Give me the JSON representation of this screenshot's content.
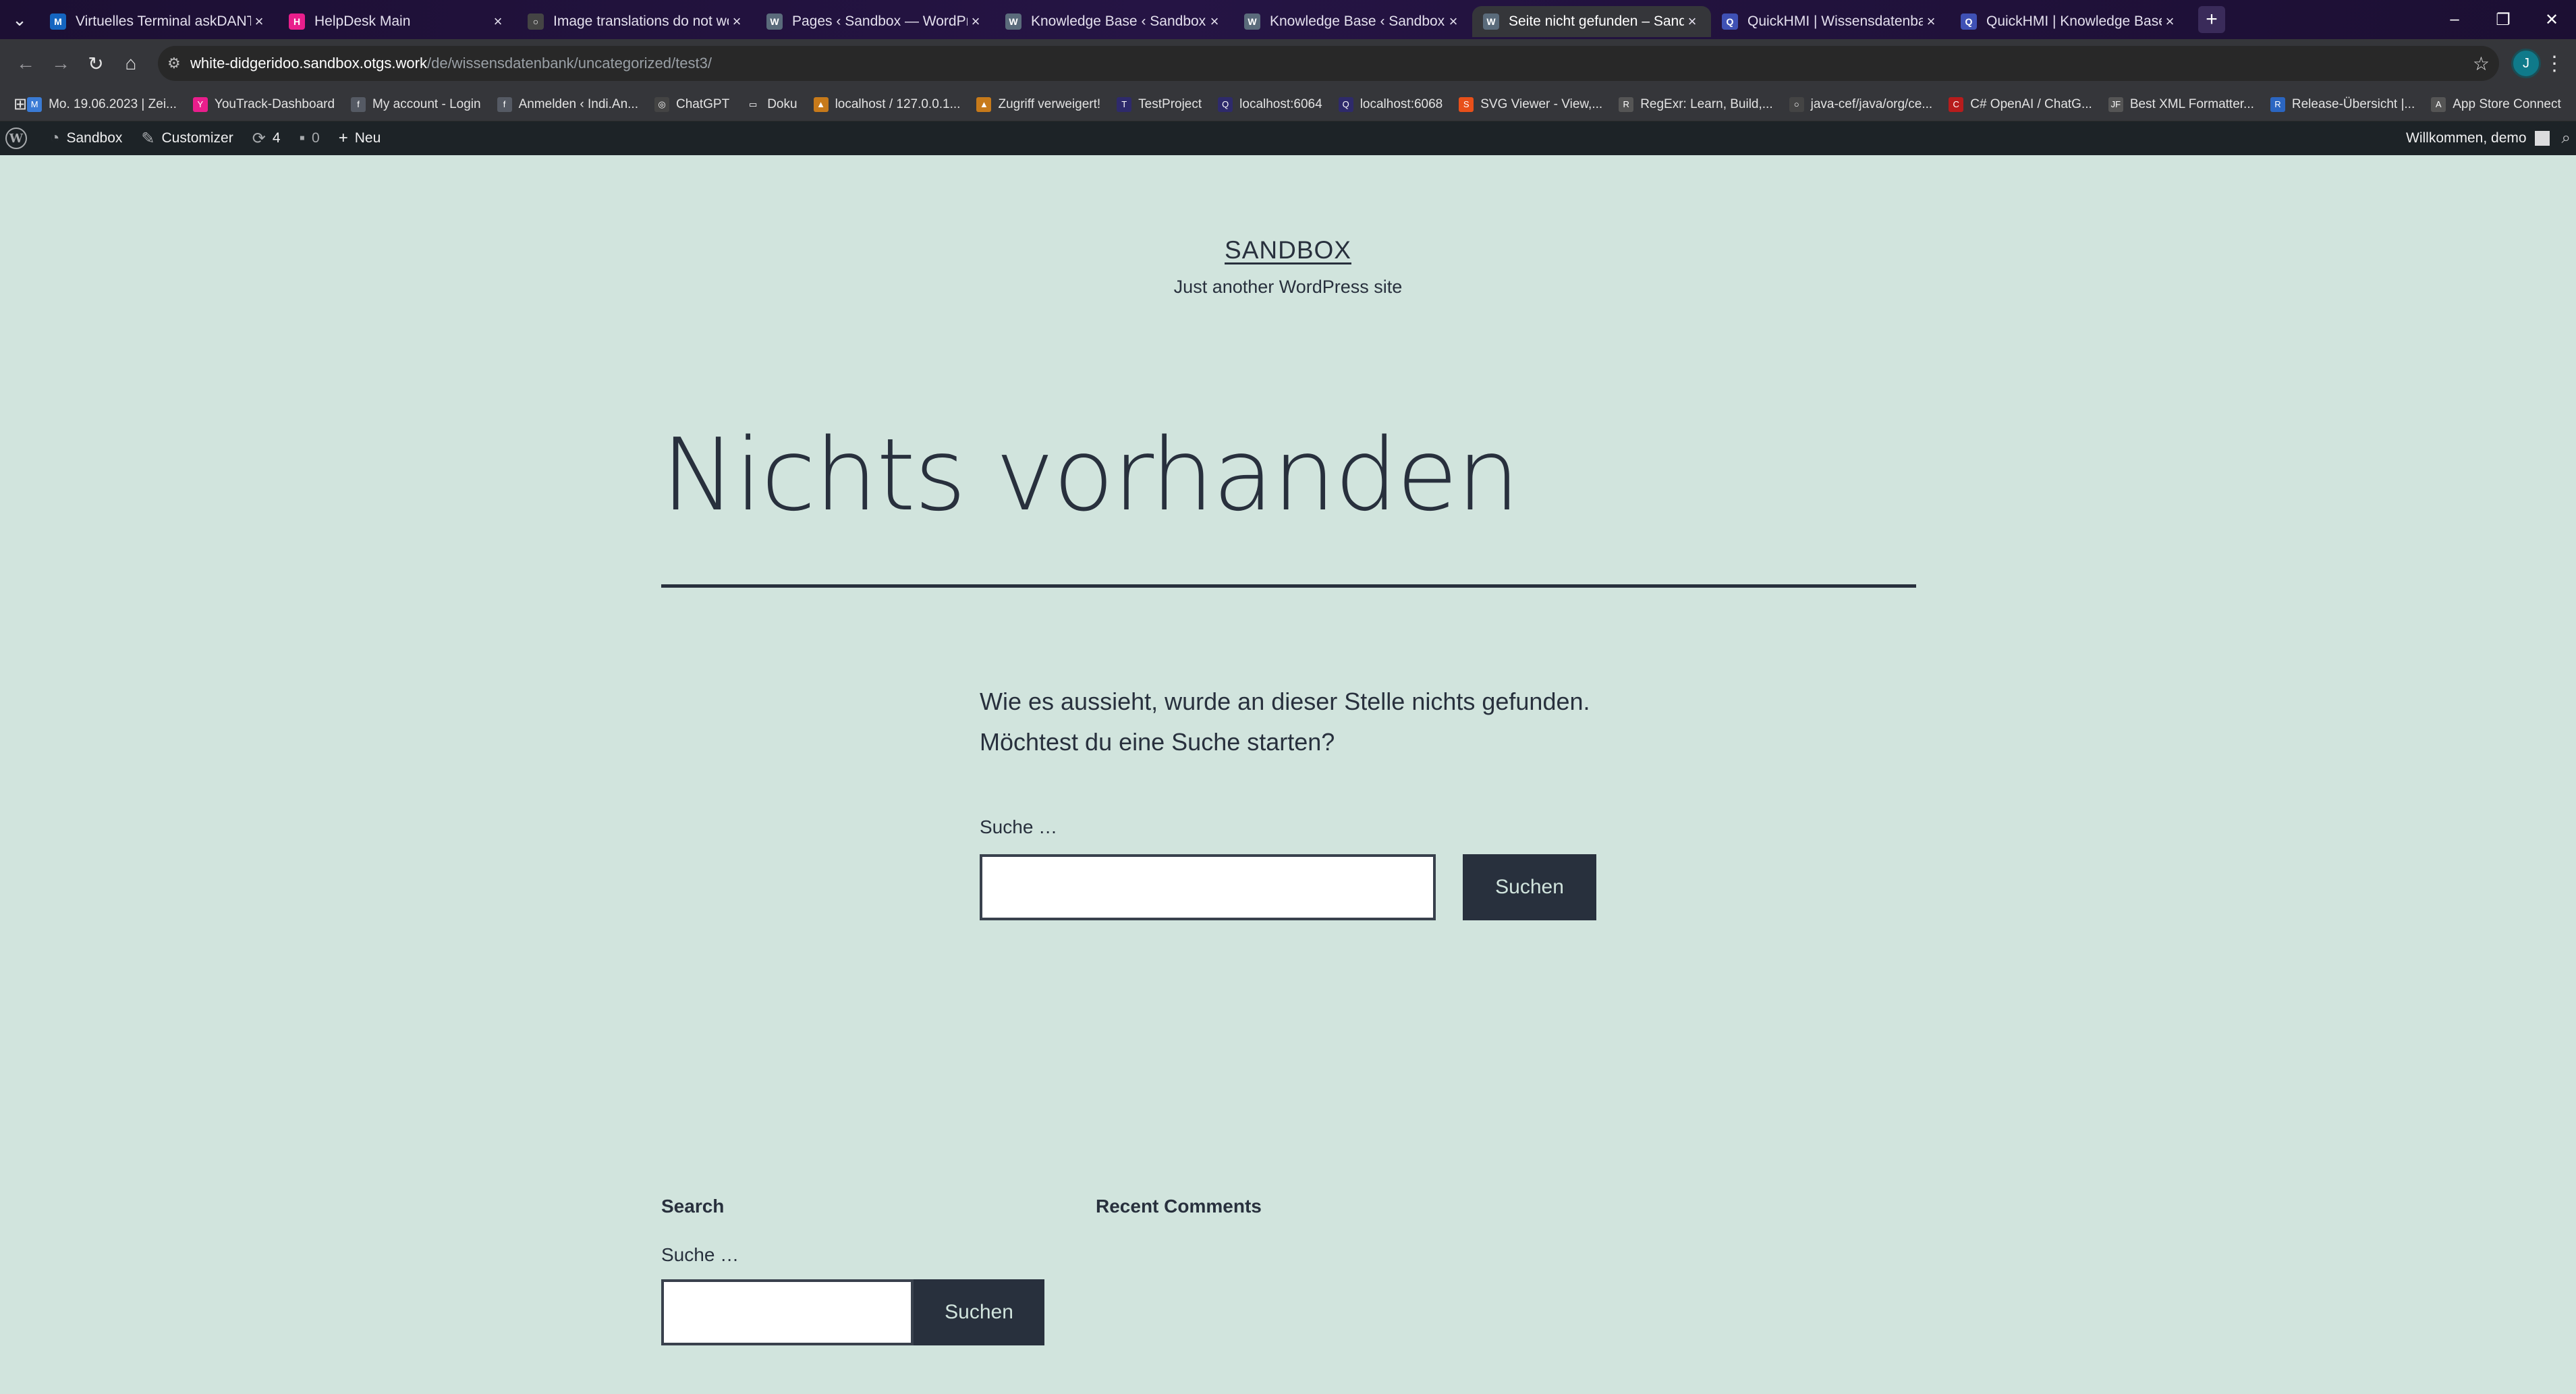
{
  "browser": {
    "tabs": [
      {
        "title": "Virtuelles Terminal askDANTE",
        "icon": "m-logo-icon",
        "color": "#1565c0",
        "glyph": "M"
      },
      {
        "title": "HelpDesk Main",
        "icon": "helpdesk-icon",
        "color": "#e91e8c",
        "glyph": "H"
      },
      {
        "title": "Image translations do not work",
        "icon": "github-icon",
        "color": "#444444",
        "glyph": "○"
      },
      {
        "title": "Pages ‹ Sandbox — WordPress",
        "icon": "wordpress-icon",
        "color": "#5a6b7b",
        "glyph": "W"
      },
      {
        "title": "Knowledge Base ‹ Sandbox — W",
        "icon": "wordpress-icon",
        "color": "#5a6b7b",
        "glyph": "W"
      },
      {
        "title": "Knowledge Base ‹ Sandbox — W",
        "icon": "wordpress-icon",
        "color": "#5a6b7b",
        "glyph": "W"
      },
      {
        "title": "Seite nicht gefunden – Sandbox",
        "icon": "wordpress-icon",
        "color": "#5a6b7b",
        "glyph": "W",
        "active": true
      },
      {
        "title": "QuickHMI | Wissensdatenbank",
        "icon": "quickhmi-icon",
        "color": "#3f51b5",
        "glyph": "Q"
      },
      {
        "title": "QuickHMI | Knowledge Base ca",
        "icon": "quickhmi-icon",
        "color": "#3f51b5",
        "glyph": "Q"
      }
    ],
    "url_host": "white-didgeridoo.sandbox.otgs.work",
    "url_path": "/de/wissensdatenbank/uncategorized/test3/",
    "profile_initial": "J",
    "bookmarks": [
      {
        "label": "Mo. 19.06.2023 | Zei...",
        "color": "#3a7bd5",
        "glyph": "M"
      },
      {
        "label": "YouTrack-Dashboard",
        "color": "#e91e8c",
        "glyph": "Y"
      },
      {
        "label": "My account - Login",
        "color": "#555a64",
        "glyph": "f"
      },
      {
        "label": "Anmelden ‹ Indi.An...",
        "color": "#555a64",
        "glyph": "f"
      },
      {
        "label": "ChatGPT",
        "color": "#444444",
        "glyph": "◎"
      },
      {
        "label": "Doku",
        "color": "#35363a",
        "glyph": "▭"
      },
      {
        "label": "localhost / 127.0.0.1...",
        "color": "#c77a1a",
        "glyph": "▲"
      },
      {
        "label": "Zugriff verweigert!",
        "color": "#c77a1a",
        "glyph": "▲"
      },
      {
        "label": "TestProject",
        "color": "#2e2a6b",
        "glyph": "T"
      },
      {
        "label": "localhost:6064",
        "color": "#2e2a6b",
        "glyph": "Q"
      },
      {
        "label": "localhost:6068",
        "color": "#2e2a6b",
        "glyph": "Q"
      },
      {
        "label": "SVG Viewer - View,...",
        "color": "#e8501a",
        "glyph": "S"
      },
      {
        "label": "RegExr: Learn, Build,...",
        "color": "#555555",
        "glyph": "R"
      },
      {
        "label": "java-cef/java/org/ce...",
        "color": "#444444",
        "glyph": "○"
      },
      {
        "label": "C# OpenAI / ChatG...",
        "color": "#b71c1c",
        "glyph": "C"
      },
      {
        "label": "Best XML Formatter...",
        "color": "#555555",
        "glyph": "JF"
      },
      {
        "label": "Release-Übersicht |...",
        "color": "#2b66c2",
        "glyph": "R"
      },
      {
        "label": "App Store Connect",
        "color": "#555555",
        "glyph": "A"
      }
    ]
  },
  "adminbar": {
    "site": "Sandbox",
    "customizer": "Customizer",
    "updates": "4",
    "comments": "0",
    "new": "Neu",
    "greeting": "Willkommen, demo"
  },
  "site": {
    "title": "SANDBOX",
    "description": "Just another WordPress site"
  },
  "content": {
    "heading": "Nichts vorhanden",
    "notice_line1": "Wie es aussieht, wurde an dieser Stelle nichts gefunden.",
    "notice_line2": "Möchtest du eine Suche starten?",
    "search_label": "Suche …",
    "search_value": "",
    "search_button": "Suchen"
  },
  "footer": {
    "search_widget_title": "Search",
    "search_label": "Suche …",
    "search_value": "",
    "search_button": "Suchen",
    "comments_widget_title": "Recent Comments"
  }
}
